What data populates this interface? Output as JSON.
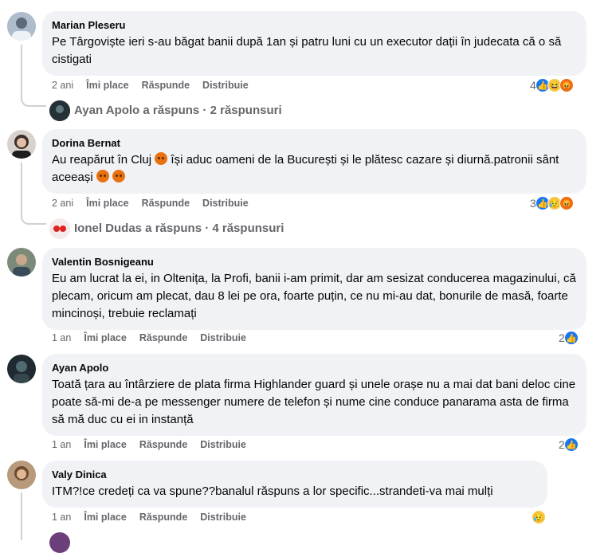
{
  "comments": [
    {
      "author": "Marian Pleseru",
      "text": "Pe Târgoviște ieri s-au băgat banii după 1an și patru luni cu un executor dații în judecata că o să cistigati",
      "time": "2 ani",
      "like": "Îmi place",
      "reply": "Răspunde",
      "share": "Distribuie",
      "reaction_count": "4",
      "replies_summary": "Ayan Apolo a răspuns · 2 răspunsuri"
    },
    {
      "author": "Dorina Bernat",
      "text_part1": "Au reapărut în Cluj ",
      "text_part2": " își aduc oameni de la București și le plătesc cazare și diurnă.patronii sânt aceeași ",
      "time": "2 ani",
      "like": "Îmi place",
      "reply": "Răspunde",
      "share": "Distribuie",
      "reaction_count": "3",
      "replies_summary": "Ionel Dudas a răspuns · 4 răspunsuri"
    },
    {
      "author": "Valentin Bosnigeanu",
      "text": "Eu am lucrat la ei, in Oltenița, la Profi, banii i-am primit, dar am sesizat conducerea magazinului, că plecam, oricum am plecat, dau 8 lei pe ora, foarte puțin, ce nu mi-au dat, bonurile de masă, foarte mincinoși, trebuie reclamați",
      "time": "1 an",
      "like": "Îmi place",
      "reply": "Răspunde",
      "share": "Distribuie",
      "reaction_count": "2"
    },
    {
      "author": "Ayan Apolo",
      "text": "Toată țara au întârziere de plata firma Highlander guard și unele orașe nu a mai dat bani deloc cine poate să-mi de-a pe messenger numere de telefon și nume cine conduce panarama asta de firma să mă duc cu ei in instanță",
      "time": "1 an",
      "like": "Îmi place",
      "reply": "Răspunde",
      "share": "Distribuie",
      "reaction_count": "2"
    },
    {
      "author": "Valy Dinica",
      "text": "ITM?!ce credeți ca va spune??banalul răspuns a lor specific...strandeti-va mai mulți",
      "time": "1 an",
      "like": "Îmi place",
      "reply": "Răspunde",
      "share": "Distribuie"
    }
  ],
  "colors": {
    "bubble": "#f0f2f5",
    "like_blue": "#1877f2",
    "meta_gray": "#65676b"
  }
}
